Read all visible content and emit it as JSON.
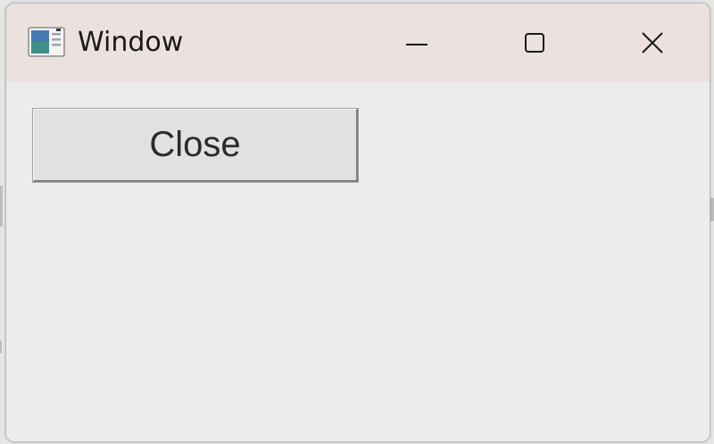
{
  "window": {
    "title": "Window",
    "icon": "app-window-icon",
    "caption_buttons": {
      "minimize_icon": "minimize-icon",
      "maximize_icon": "maximize-icon",
      "close_icon": "close-icon"
    }
  },
  "client": {
    "close_button_label": "Close"
  },
  "colors": {
    "titlebar": "#ebe1de",
    "client_bg": "#ececec",
    "button_face": "#e1e1e1",
    "text": "#1a1a1a"
  }
}
